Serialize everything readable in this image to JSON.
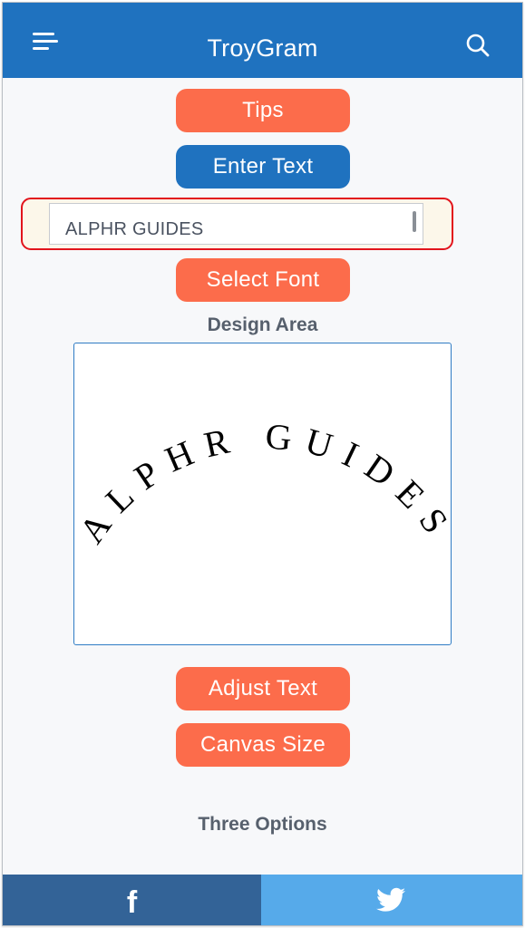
{
  "header": {
    "title": "TroyGram",
    "menu_icon": "hamburger-menu-icon",
    "search_icon": "search-icon"
  },
  "buttons": {
    "tips": "Tips",
    "enter_text": "Enter Text",
    "select_font": "Select Font",
    "adjust_text": "Adjust Text",
    "canvas_size": "Canvas Size"
  },
  "text_input": {
    "value": "ALPHR GUIDES"
  },
  "design_area": {
    "label": "Design Area",
    "curved_text": "ALPHR GUIDES"
  },
  "options_label": "Three Options",
  "footer": {
    "facebook_icon": "facebook-icon",
    "twitter_icon": "twitter-icon"
  },
  "colors": {
    "primary_blue": "#1f72bf",
    "accent_orange": "#fc6c4b",
    "highlight_red": "#e2141c",
    "facebook_blue": "#336397",
    "twitter_blue": "#56aaea"
  }
}
